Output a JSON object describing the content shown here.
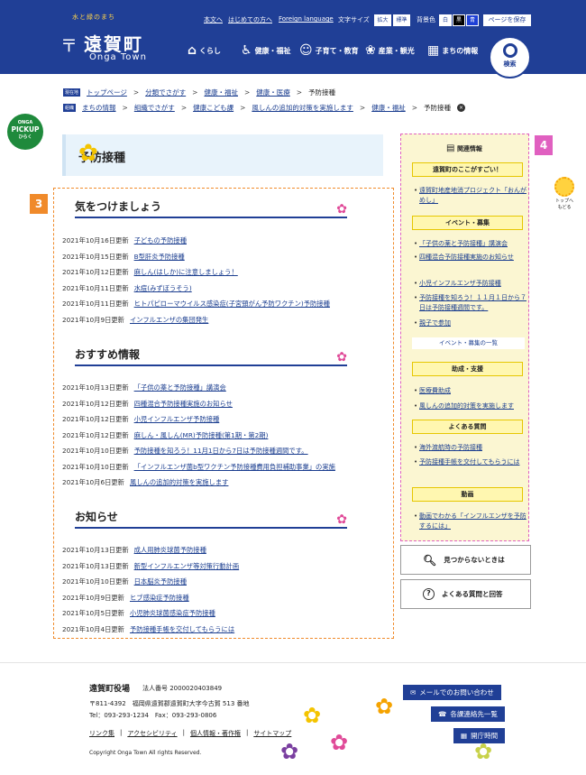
{
  "header": {
    "tagline": "水と緑のまち",
    "town_name": "遠賀町",
    "town_name_en": "Onga Town",
    "util": {
      "honbun": "本文へ",
      "first": "はじめての方へ",
      "foreign": "Foreign language",
      "fontsize": "文字サイズ",
      "enlarge": "拡大",
      "standard": "標準",
      "bgcolor": "背景色",
      "white": "白",
      "black": "黒",
      "blue": "青",
      "save": "ページを保存"
    },
    "nav": [
      {
        "label": "くらし",
        "icon": "home-icon"
      },
      {
        "label": "健康・福祉",
        "icon": "health-icon"
      },
      {
        "label": "子育て・教育",
        "icon": "child-icon"
      },
      {
        "label": "産業・観光",
        "icon": "industry-icon"
      },
      {
        "label": "まちの情報",
        "icon": "building-icon"
      }
    ],
    "search": "検索"
  },
  "breadcrumb1": {
    "tag": "現在地",
    "items": [
      "トップページ",
      "分類でさがす",
      "健康・福祉",
      "健康・医療",
      "予防接種"
    ]
  },
  "breadcrumb2": {
    "tag": "組織",
    "items": [
      "まちの情報",
      "組織でさがす",
      "健康こども課",
      "風しんの追加的対策を実施します",
      "健康・福祉",
      "予防接種"
    ]
  },
  "pickup": {
    "l1": "ONGA",
    "l2": "PICKUP",
    "l3": "ひらく"
  },
  "page_title": "予防接種",
  "badges": {
    "main": "3",
    "side": "4"
  },
  "sections": [
    {
      "title": "気をつけましょう",
      "rows": [
        {
          "date": "2021年10月16日更新",
          "text": "子どもの予防接種"
        },
        {
          "date": "2021年10月15日更新",
          "text": "B型肝炎予防接種"
        },
        {
          "date": "2021年10月12日更新",
          "text": "麻しん(はしか)に注意しましょう！"
        },
        {
          "date": "2021年10月11日更新",
          "text": "水痘(みずぼうそう)"
        },
        {
          "date": "2021年10月11日更新",
          "text": "ヒトパピローマウイルス感染症(子宮頸がん予防ワクチン)予防接種"
        },
        {
          "date": "2021年10月9日更新",
          "text": "インフルエンザの集団発生"
        }
      ]
    },
    {
      "title": "おすすめ情報",
      "rows": [
        {
          "date": "2021年10月13日更新",
          "text": "「子供の薬と予防接種」講演会"
        },
        {
          "date": "2021年10月12日更新",
          "text": "四種混合予防接種実施のお知らせ"
        },
        {
          "date": "2021年10月12日更新",
          "text": "小児インフルエンザ予防接種"
        },
        {
          "date": "2021年10月12日更新",
          "text": "麻しん・風しん(MR)予防接種(第1期・第2期)"
        },
        {
          "date": "2021年10月10日更新",
          "text": "予防接種を知ろう！11月1日から7日は予防接種週間です。"
        },
        {
          "date": "2021年10月10日更新",
          "text": "「インフルエンザ菌b型ワクチン予防接種費用負担補助事業」の実施"
        },
        {
          "date": "2021年10月6日更新",
          "text": "風しんの追加的対策を実施します"
        }
      ]
    },
    {
      "title": "お知らせ",
      "rows": [
        {
          "date": "2021年10月13日更新",
          "text": "成人用肺炎球菌予防接種"
        },
        {
          "date": "2021年10月13日更新",
          "text": "新型インフルエンザ等対策行動計画"
        },
        {
          "date": "2021年10月10日更新",
          "text": "日本脳炎予防接種"
        },
        {
          "date": "2021年10月9日更新",
          "text": "ヒブ感染症予防接種"
        },
        {
          "date": "2021年10月5日更新",
          "text": "小児肺炎球菌感染症予防接種"
        },
        {
          "date": "2021年10月4日更新",
          "text": "予防接種手帳を交付してもらうには"
        }
      ]
    }
  ],
  "sidebar": {
    "title": "関連情報",
    "h1": "遠賀町のここがすごい！",
    "l1": [
      "遠賀町地産地消プロジェクト「おんがめし」"
    ],
    "h2": "イベント・募集",
    "l2": [
      "「子供の薬と予防接種」講演会",
      "四種混合予防接種実施のお知らせ",
      "小児インフルエンザ予防接種",
      "予防接種を知ろう！１１月１日から７日は予防接種週間です。",
      "親子で参加"
    ],
    "more": "イベント・募集の一覧",
    "h3": "助成・支援",
    "l3": [
      "医療費助成",
      "風しんの追加的対策を実施します"
    ],
    "h4": "よくある質問",
    "l4": [
      "海外渡航時の予防接種",
      "予防接種手帳を交付してもらうには"
    ],
    "h5": "動画",
    "l5": [
      "動画でわかる「インフルエンザを予防するには」"
    ]
  },
  "buttons": {
    "notfound": "見つからないときは",
    "faq": "よくある質問と回答"
  },
  "totop": {
    "l1": "トップへ",
    "l2": "もどる"
  },
  "footer": {
    "office": "遠賀町役場",
    "corp": "法人番号 2000020403849",
    "address": "〒811-4392　福岡県遠賀郡遠賀町大字今古賀 513 番地",
    "phone": "Tel：093-293-1234　Fax：093-293-0806",
    "links": [
      "リンク集",
      "アクセシビリティ",
      "個人情報・著作権",
      "サイトマップ"
    ],
    "copyright": "Copyright Onga Town All rights Reserved.",
    "mail": "メールでのお問い合わせ",
    "dept": "各課連絡先一覧",
    "hours": "開庁時間"
  }
}
